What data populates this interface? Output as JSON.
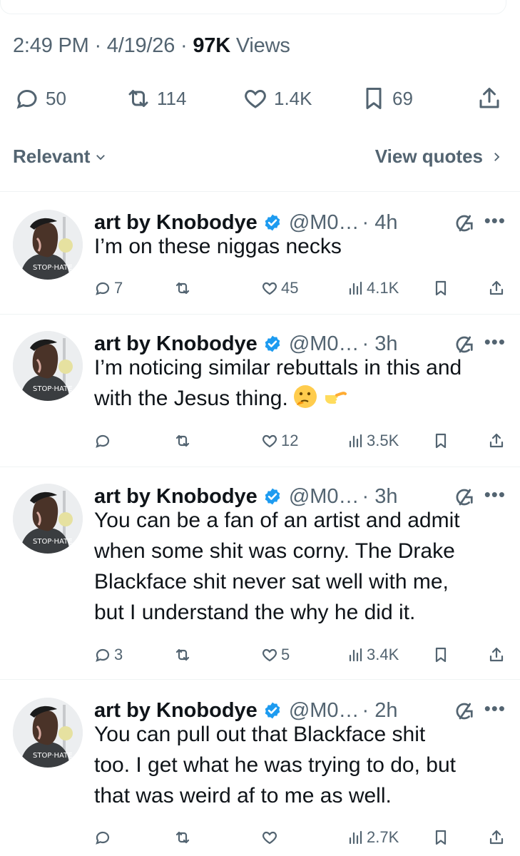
{
  "post_meta": {
    "time": "2:49 PM",
    "sep1": "·",
    "date": "4/19/26",
    "sep2": "·",
    "views_count": "97K",
    "views_label": "Views"
  },
  "post_actions": {
    "replies": "50",
    "reposts": "114",
    "likes": "1.4K",
    "bookmarks": "69"
  },
  "sort": {
    "label": "Relevant",
    "view_quotes": "View quotes"
  },
  "replies": [
    {
      "name": "art by Knobodye",
      "handle": "@M0…",
      "time": "· 4h",
      "lines": [
        "I’m on these niggas necks"
      ],
      "stats": {
        "replies": "7",
        "reposts": "",
        "likes": "45",
        "views": "4.1K"
      }
    },
    {
      "name": "art by Knobodye",
      "handle": "@M0…",
      "time": "· 3h",
      "lines": [
        "I’m noticing similar rebuttals in this and",
        "with the Jesus thing."
      ],
      "stats": {
        "replies": "",
        "reposts": "",
        "likes": "12",
        "views": "3.5K"
      }
    },
    {
      "name": "art by Knobodye",
      "handle": "@M0…",
      "time": "· 3h",
      "lines": [
        "You can be a fan of an artist and admit",
        "when some shit was corny. The Drake",
        "Blackface shit never sat well with me,",
        "but I understand the why he did it."
      ],
      "stats": {
        "replies": "3",
        "reposts": "",
        "likes": "5",
        "views": "3.4K"
      }
    },
    {
      "name": "art by Knobodye",
      "handle": "@M0…",
      "time": "· 2h",
      "lines": [
        "You can pull out that Blackface shit",
        "too. I get what he was trying to do, but",
        "that was weird  af to me as well."
      ],
      "stats": {
        "replies": "",
        "reposts": "",
        "likes": "",
        "views": "2.7K"
      }
    }
  ],
  "icons": {
    "reply": "speech-bubble-icon",
    "repost": "repost-arrows-icon",
    "like": "heart-icon",
    "views": "bar-chart-icon",
    "bookmark": "bookmark-icon",
    "share": "share-upload-icon",
    "verified": "verified-badge-icon",
    "grok": "grok-icon",
    "more": "more-dots-icon"
  },
  "colors": {
    "verified": "#1d9bf0",
    "muted": "#536471",
    "text": "#0f1419"
  }
}
